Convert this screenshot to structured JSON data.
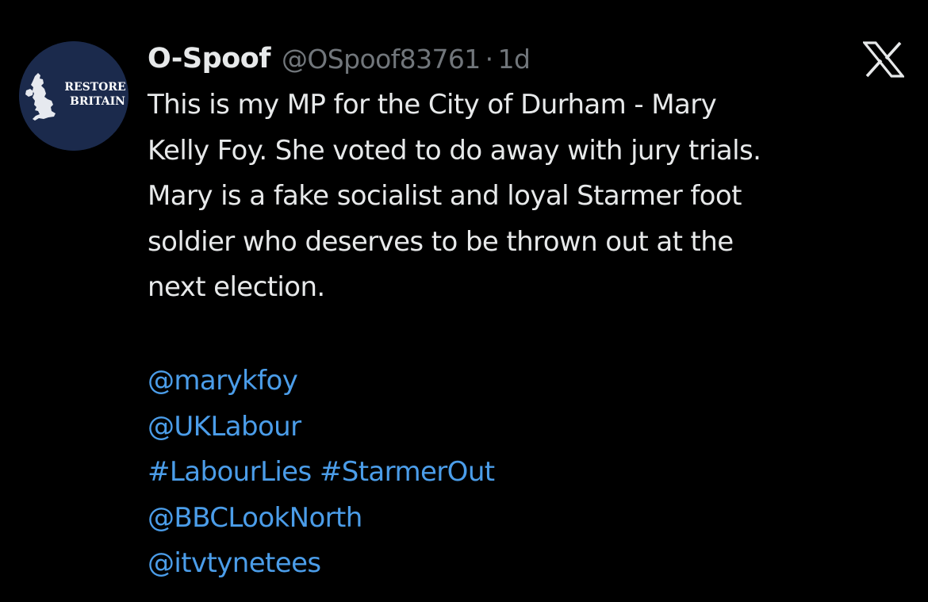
{
  "colors": {
    "background": "#000000",
    "text": "#e7e9ea",
    "muted": "#71767b",
    "link": "#4b9de9",
    "avatar_bg": "#1b2a4c"
  },
  "avatar": {
    "text_line1": "RESTORE",
    "text_line2": "BRITAIN"
  },
  "header": {
    "display_name": "O-Spoof",
    "handle": "@OSpoof83761",
    "separator": "·",
    "time": "1d"
  },
  "close_icon": "x-logo-icon",
  "body_lines": [
    "This is my MP for the City of Durham - Mary",
    "Kelly Foy. She voted to do away with jury trials.",
    "Mary is a fake socialist and loyal Starmer foot",
    "soldier who deserves to be thrown out at the",
    "next election."
  ],
  "mentions": {
    "line1": "@marykfoy",
    "line2": "@UKLabour",
    "hashtag1": "#LabourLies",
    "hashtag2": "#StarmerOut",
    "line4": "@BBCLookNorth",
    "line5": "@itvtynetees"
  }
}
